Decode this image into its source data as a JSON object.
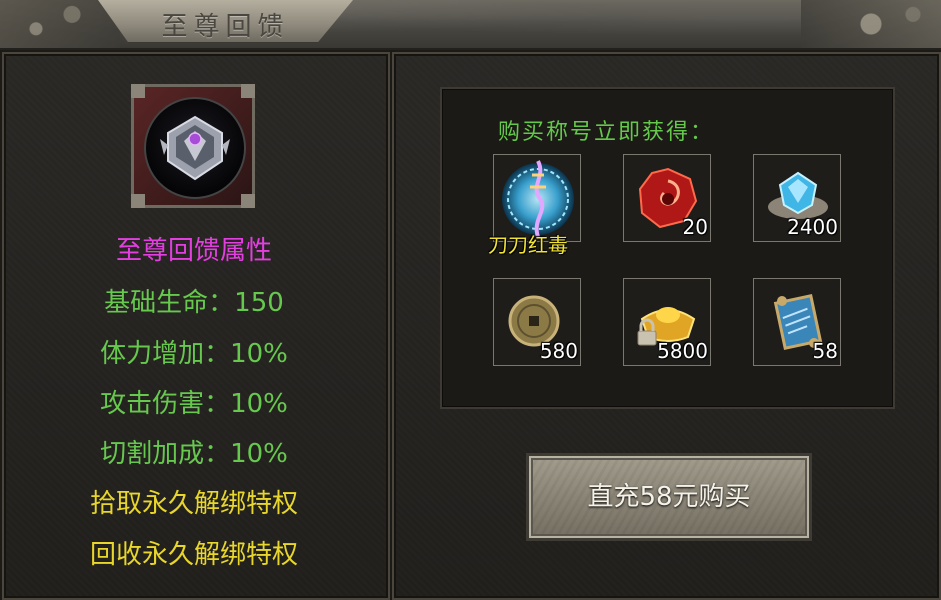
{
  "window": {
    "title": "至尊回馈"
  },
  "attributes": {
    "title": "至尊回馈属性",
    "lines": [
      {
        "text": "基础生命：150",
        "color": "#66c94e"
      },
      {
        "text": "体力增加：10%",
        "color": "#66c94e"
      },
      {
        "text": "攻击伤害：10%",
        "color": "#66c94e"
      },
      {
        "text": "切割加成：10%",
        "color": "#66c94e"
      },
      {
        "text": "拾取永久解绑特权",
        "color": "#e8d62a"
      },
      {
        "text": "回收永久解绑特权",
        "color": "#e8d62a"
      }
    ]
  },
  "rewards": {
    "caption": "购买称号立即获得：",
    "items": [
      {
        "icon": "title-orb-icon",
        "name": "刀刀红毒",
        "qty": ""
      },
      {
        "icon": "red-gem-icon",
        "name": "",
        "qty": "20"
      },
      {
        "icon": "blue-crystal-icon",
        "name": "",
        "qty": "2400"
      },
      {
        "icon": "ancient-coin-icon",
        "name": "",
        "qty": "580"
      },
      {
        "icon": "gold-ingot-lock-icon",
        "name": "",
        "qty": "5800"
      },
      {
        "icon": "scroll-icon",
        "name": "",
        "qty": "58"
      }
    ]
  },
  "buy_button": {
    "label": "直充58元购买"
  },
  "colors": {
    "attr_title": "#e33fe0",
    "stat_green": "#66c94e",
    "privilege_yellow": "#e8d62a"
  }
}
